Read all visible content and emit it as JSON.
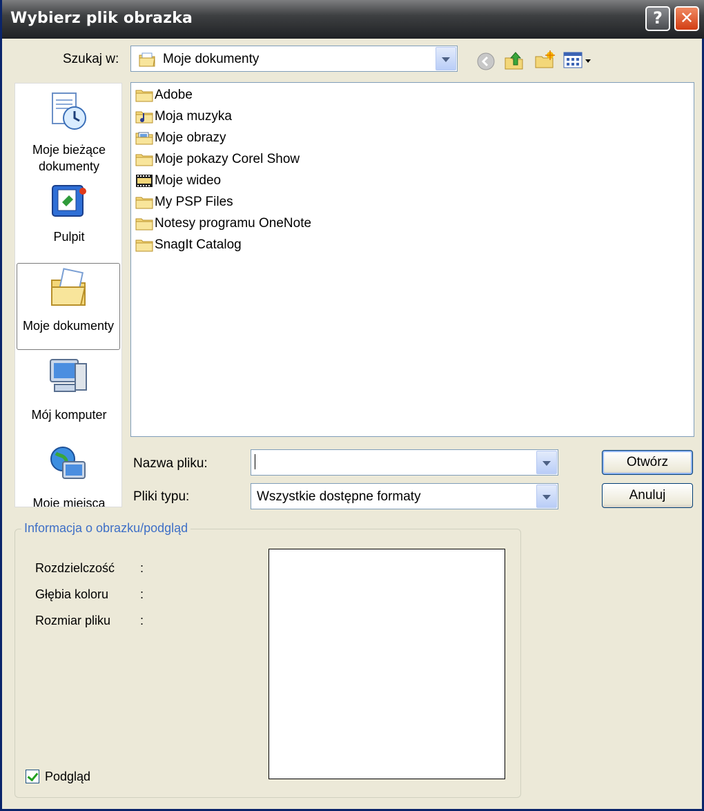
{
  "window": {
    "title": "Wybierz plik obrazka",
    "help_label": "?",
    "close_label": "✕"
  },
  "lookin": {
    "label": "Szukaj w:",
    "value": "Moje dokumenty"
  },
  "toolbar_icons": [
    "back-icon",
    "up-folder-icon",
    "new-folder-icon",
    "view-menu-icon"
  ],
  "places": [
    {
      "label": "Moje bieżące dokumenty",
      "icon": "recent-documents-icon"
    },
    {
      "label": "Pulpit",
      "icon": "desktop-icon"
    },
    {
      "label": "Moje dokumenty",
      "icon": "my-documents-icon",
      "selected": true
    },
    {
      "label": "Mój komputer",
      "icon": "my-computer-icon"
    },
    {
      "label": "Moje miejsca",
      "icon": "network-places-icon"
    }
  ],
  "files": [
    {
      "name": "Adobe",
      "icon": "folder-icon"
    },
    {
      "name": "Moja muzyka",
      "icon": "music-folder-icon"
    },
    {
      "name": "Moje obrazy",
      "icon": "pictures-folder-icon"
    },
    {
      "name": "Moje pokazy Corel Show",
      "icon": "folder-icon"
    },
    {
      "name": "Moje wideo",
      "icon": "video-folder-icon"
    },
    {
      "name": "My PSP Files",
      "icon": "folder-icon"
    },
    {
      "name": "Notesy programu OneNote",
      "icon": "folder-icon"
    },
    {
      "name": "SnagIt Catalog",
      "icon": "folder-icon"
    }
  ],
  "filename": {
    "label": "Nazwa pliku:",
    "value": ""
  },
  "filetype": {
    "label": "Pliki typu:",
    "value": "Wszystkie dostępne formaty"
  },
  "buttons": {
    "open": "Otwórz",
    "cancel": "Anuluj"
  },
  "info": {
    "title": "Informacja o obrazku/podgląd",
    "rows": [
      {
        "label": "Rozdzielczość",
        "colon": ":"
      },
      {
        "label": "Głębia koloru",
        "colon": ":"
      },
      {
        "label": "Rozmiar pliku",
        "colon": ":"
      }
    ],
    "preview_checkbox_label": "Podgląd",
    "preview_checked": true
  }
}
